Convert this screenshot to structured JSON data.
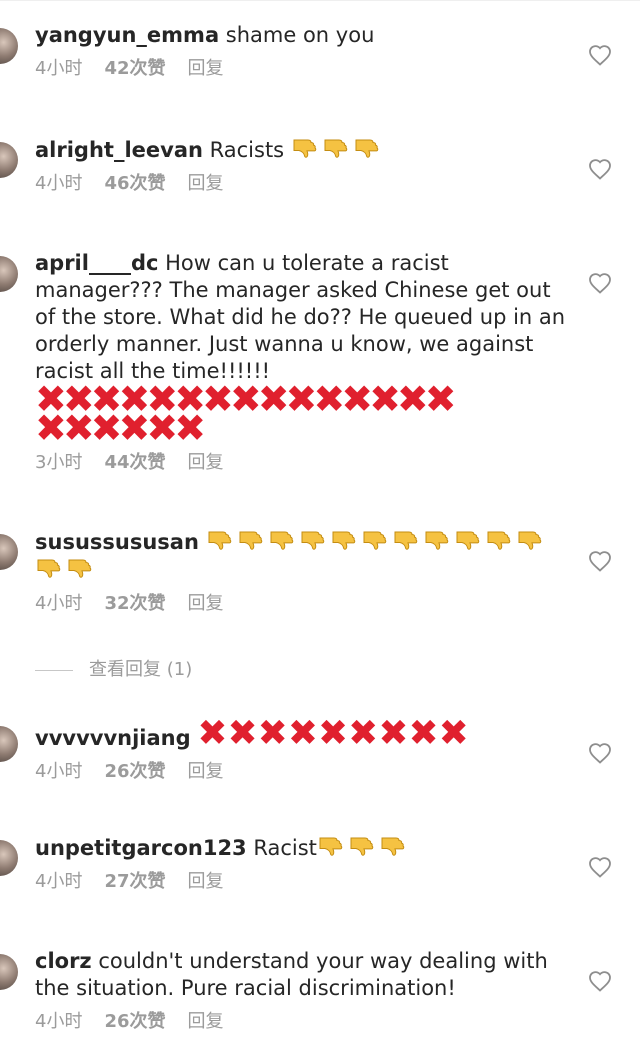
{
  "comments": [
    {
      "username": "yangyun_emma",
      "text": " shame on you",
      "time": "4小时",
      "likes": "42次赞",
      "reply": "回复"
    },
    {
      "username": "alright_leevan",
      "text": " Racists",
      "time": "4小时",
      "likes": "46次赞",
      "reply": "回复"
    },
    {
      "username": "april____dc",
      "text": " How can u tolerate a racist manager??? The manager asked Chinese get out of the store.  What did he do?? He queued up in an orderly manner.  Just wanna u know, we against racist all the time!!!!!!",
      "time": "3小时",
      "likes": "44次赞",
      "reply": "回复"
    },
    {
      "username": "susussususan",
      "text": "",
      "time": "4小时",
      "likes": "32次赞",
      "reply": "回复"
    },
    {
      "username": "vvvvvvnjiang",
      "text": "",
      "time": "4小时",
      "likes": "26次赞",
      "reply": "回复"
    },
    {
      "username": "unpetitgarcon123",
      "text": " Racist",
      "time": "4小时",
      "likes": "27次赞",
      "reply": "回复"
    },
    {
      "username": "clorz",
      "text": " couldn't understand your way dealing with the situation. Pure racial discrimination!",
      "time": "4小时",
      "likes": "26次赞",
      "reply": "回复"
    }
  ],
  "view_replies": "查看回复 (1)",
  "emojis": {
    "thumbs_down": "thumbs-down-emoji",
    "cross": "cross-mark-emoji"
  },
  "colors": {
    "text": "#262626",
    "meta": "#9b9b9b",
    "cross": "#e0202e",
    "emoji": "#f5c242"
  }
}
